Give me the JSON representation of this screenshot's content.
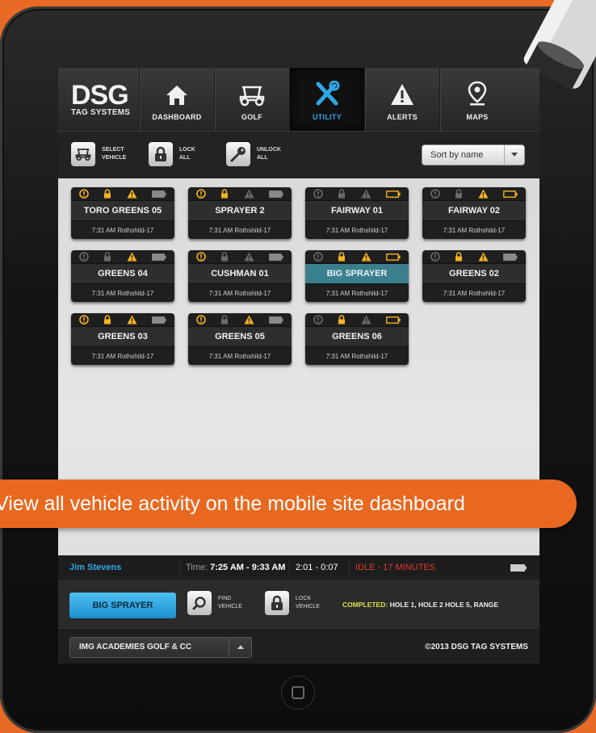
{
  "brand": {
    "logo": "DSG",
    "sub": "TAG SYSTEMS"
  },
  "nav": [
    {
      "label": "DASHBOARD",
      "icon": "home-icon",
      "active": false
    },
    {
      "label": "GOLF",
      "icon": "golf-cart-icon",
      "active": false
    },
    {
      "label": "UTILITY",
      "icon": "tools-icon",
      "active": true
    },
    {
      "label": "ALERTS",
      "icon": "alert-icon",
      "active": false
    },
    {
      "label": "MAPS",
      "icon": "map-pin-icon",
      "active": false
    }
  ],
  "toolbar": {
    "select": [
      "SELECT",
      "VEHICLE"
    ],
    "lock": [
      "LOCK",
      "ALL"
    ],
    "unlock": [
      "UNLOCK",
      "ALL"
    ],
    "sort": "Sort by name"
  },
  "vehicles": [
    {
      "name": "TORO GREENS 05",
      "time": "7:31 AM Rothshild-17",
      "status": [
        true,
        true,
        true,
        false
      ]
    },
    {
      "name": "SPRAYER 2",
      "time": "7:31 AM Rothshild-17",
      "status": [
        true,
        true,
        false,
        false
      ]
    },
    {
      "name": "FAIRWAY 01",
      "time": "7:31 AM Rothshild-17",
      "status": [
        false,
        false,
        false,
        true
      ]
    },
    {
      "name": "FAIRWAY 02",
      "time": "7:31 AM Rothshild-17",
      "status": [
        false,
        false,
        true,
        true
      ]
    },
    {
      "name": "GREENS 04",
      "time": "7:31 AM Rothshild-17",
      "status": [
        false,
        false,
        true,
        false
      ]
    },
    {
      "name": "CUSHMAN 01",
      "time": "7:31 AM Rothshild-17",
      "status": [
        true,
        false,
        false,
        false
      ]
    },
    {
      "name": "BIG SPRAYER",
      "time": "7:31 AM Rothshild-17",
      "status": [
        false,
        true,
        true,
        true
      ],
      "selected": true
    },
    {
      "name": "GREENS 02",
      "time": "7:31 AM Rothshild-17",
      "status": [
        false,
        true,
        true,
        false
      ]
    },
    {
      "name": "GREENS 03",
      "time": "7:31 AM Rothshild-17",
      "status": [
        true,
        true,
        true,
        false
      ]
    },
    {
      "name": "GREENS 05",
      "time": "7:31 AM Rothshild-17",
      "status": [
        true,
        false,
        true,
        false
      ]
    },
    {
      "name": "GREENS 06",
      "time": "7:31 AM Rothshild-17",
      "status": [
        false,
        true,
        false,
        true
      ]
    }
  ],
  "status": {
    "user": "Jim Stevens",
    "time_label": "Time:",
    "time_range": "7:25 AM - 9:33 AM",
    "duration": "2:01 - 0:07",
    "idle": "IDLE - 17 MINUTES"
  },
  "bottom": {
    "selected_vehicle": "BIG SPRAYER",
    "find": [
      "FIND",
      "VEHICLE"
    ],
    "lock": [
      "LOCK",
      "VEHICLE"
    ],
    "completed_label": "COMPLETED:",
    "completed_value": "HOLE 1, HOLE 2 HOLE 5, RANGE",
    "course": "IMG ACADEMIES GOLF & CC",
    "copyright": "©2013 DSG TAG SYSTEMS"
  },
  "banner": "View all vehicle activity on the mobile site dashboard",
  "colors": {
    "accent": "#2fa7e8",
    "warning": "#f5b321",
    "idle": "#e8382b",
    "selected": "#3b7f8e",
    "banner": "#e8681f"
  }
}
